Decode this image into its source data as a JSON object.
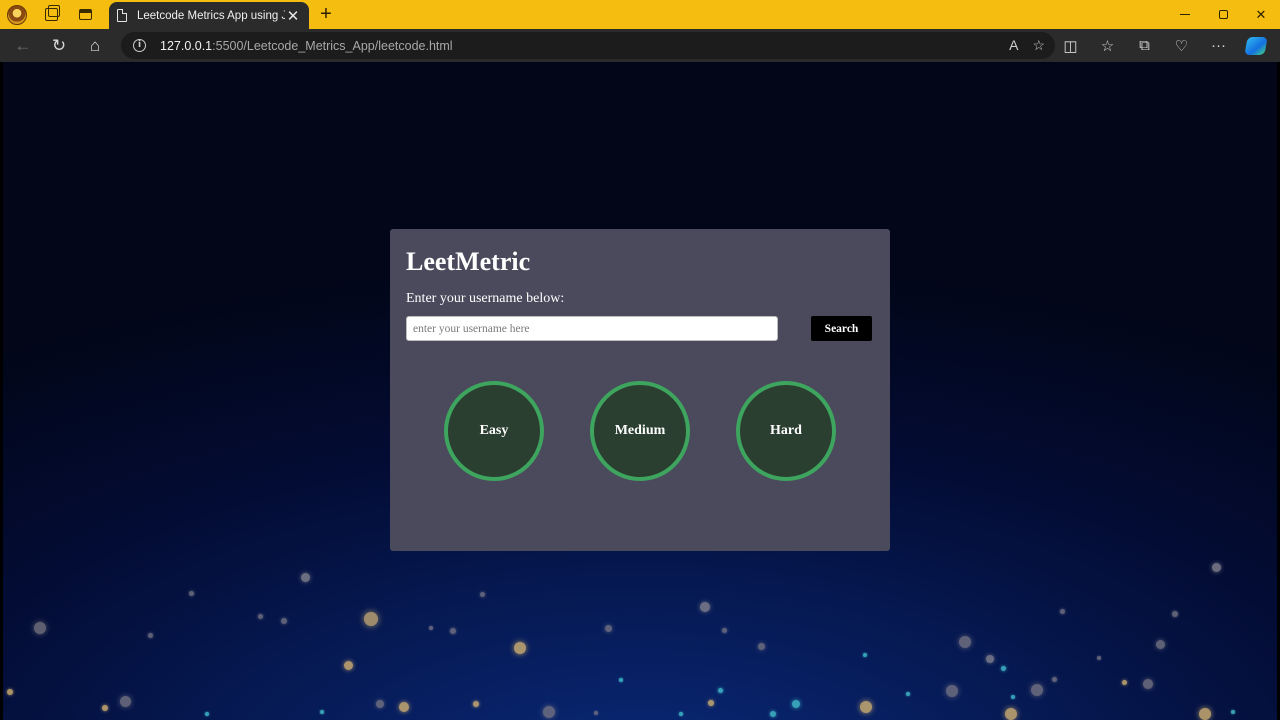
{
  "browser": {
    "tab_title": "Leetcode Metrics App using JS",
    "tab_close": "✕",
    "new_tab": "+",
    "url_host": "127.0.0.1",
    "url_path": ":5500/Leetcode_Metrics_App/leetcode.html",
    "icons": {
      "back": "←",
      "reload": "↻",
      "home": "⌂",
      "info": "i",
      "read_aloud": "A",
      "favorite": "☆",
      "split": "◫",
      "favorites": "☆",
      "collections": "⧉",
      "health": "♡",
      "more": "···"
    }
  },
  "app": {
    "title": "LeetMetric",
    "prompt": "Enter your username below:",
    "input_value": "",
    "input_placeholder": "enter your username here",
    "search_label": "Search",
    "circles": [
      {
        "label": "Easy"
      },
      {
        "label": "Medium"
      },
      {
        "label": "Hard"
      }
    ]
  },
  "colors": {
    "titlebar": "#f4bd10",
    "card": "#4b4a5c",
    "circle_border": "#3ea55f",
    "circle_fill": "#2b3f31"
  }
}
